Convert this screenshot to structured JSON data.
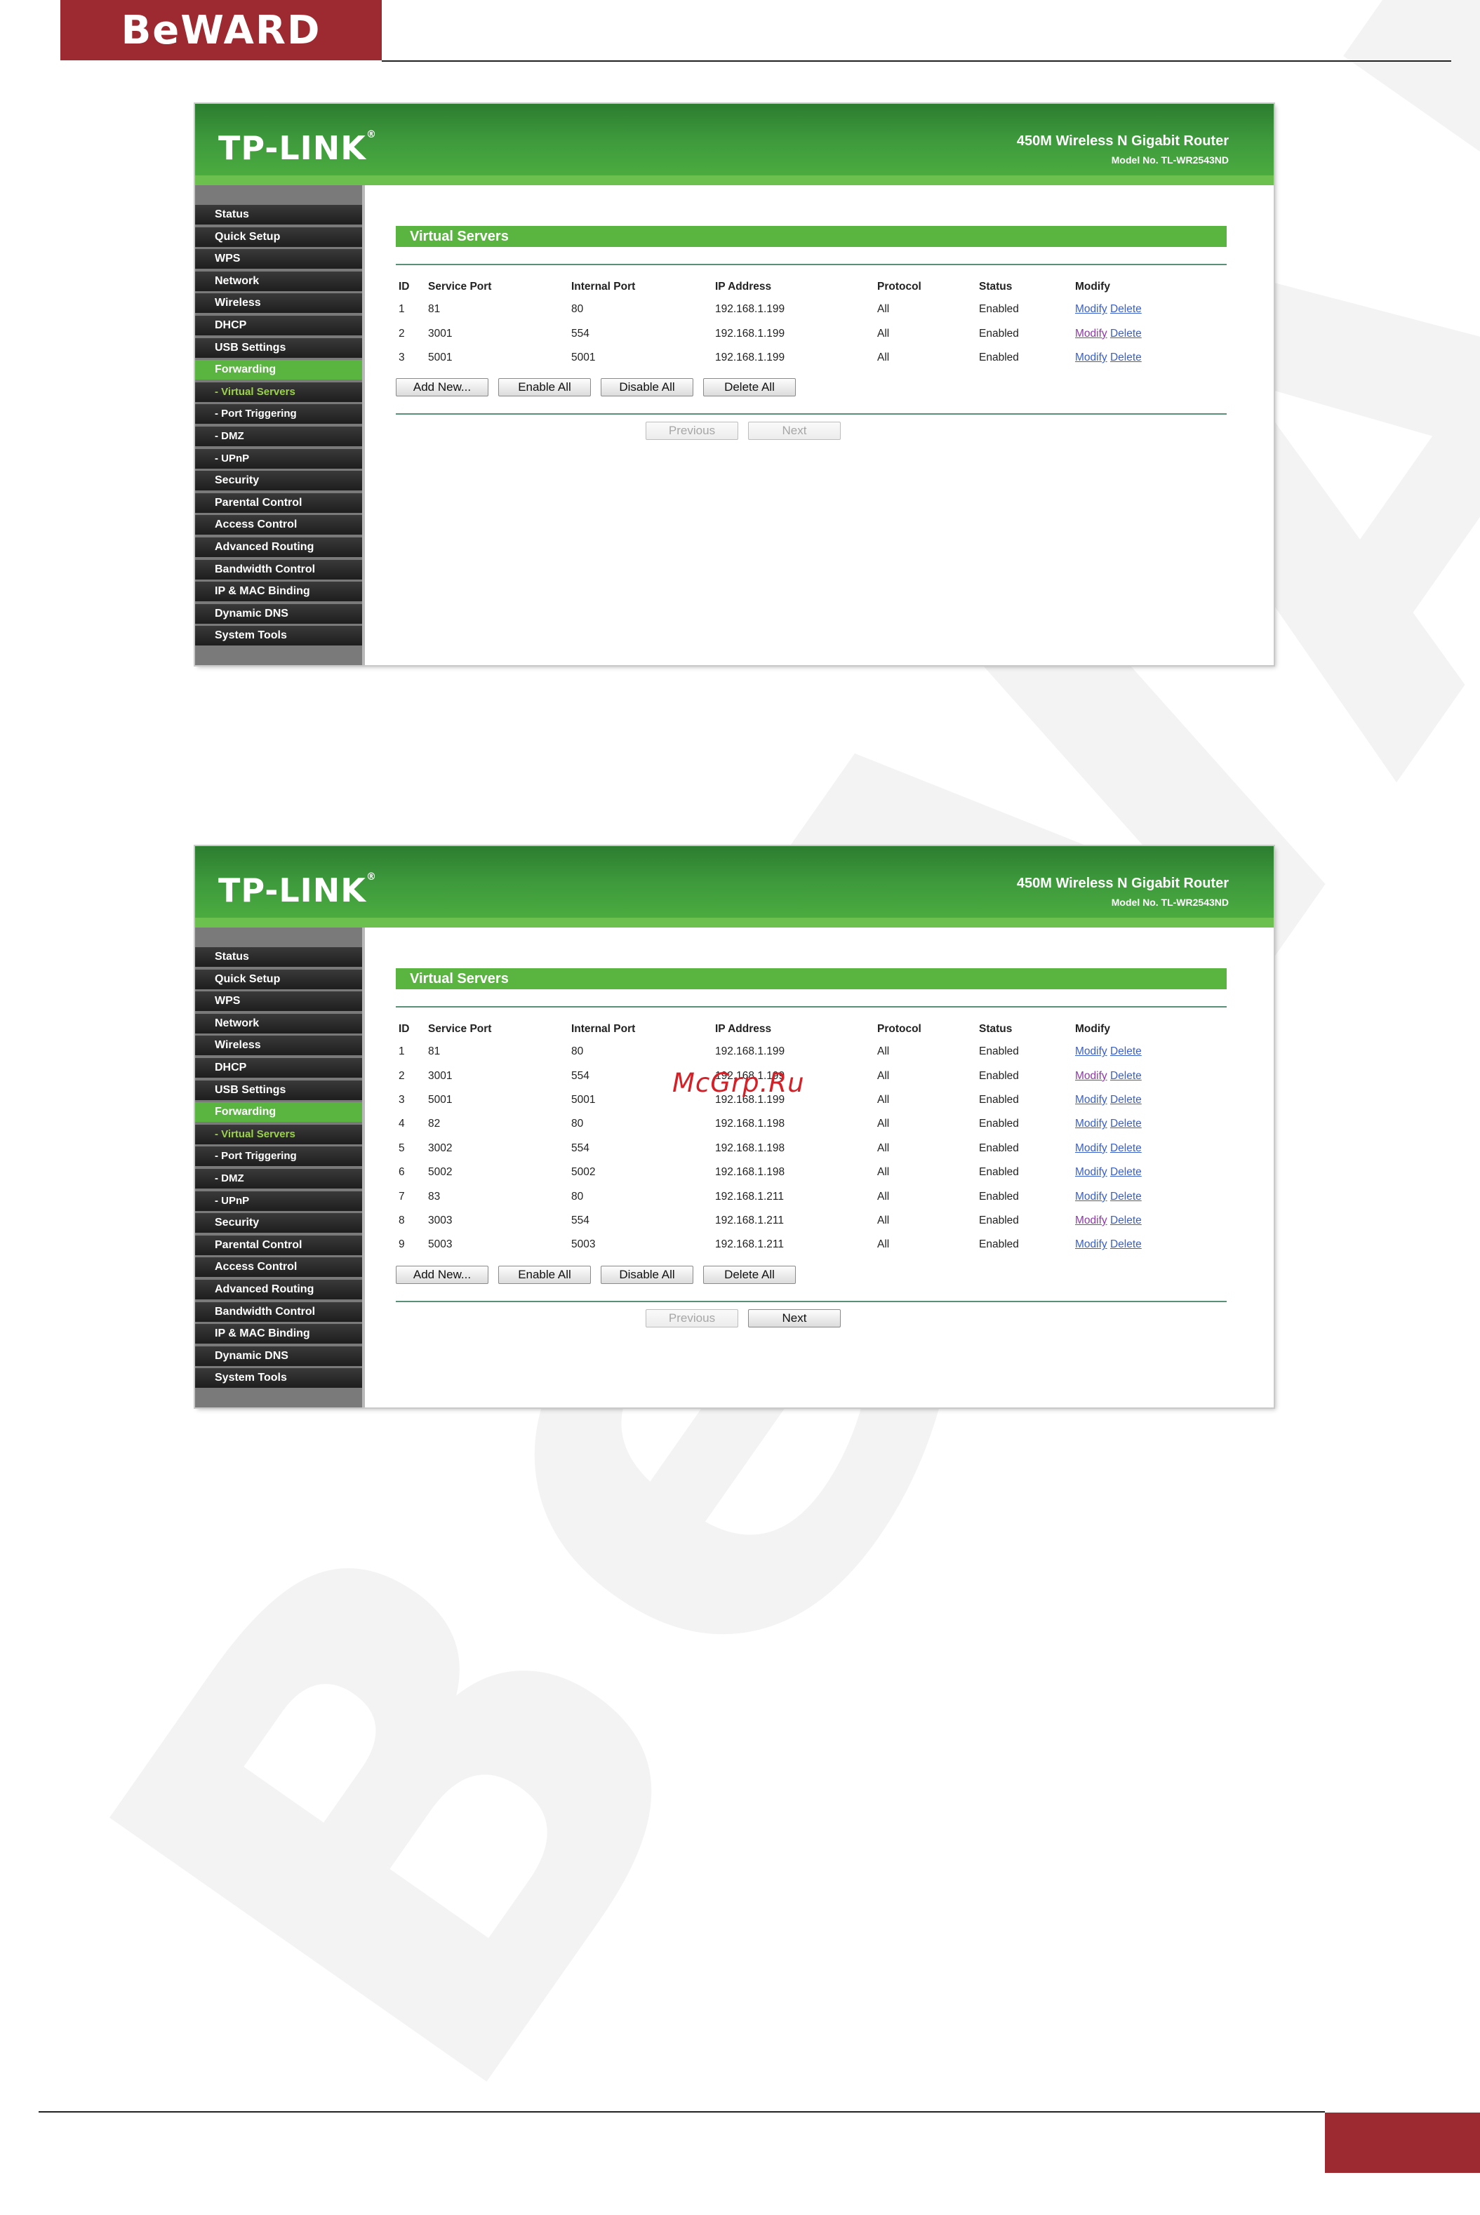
{
  "page": {
    "brand": "BeWARD",
    "watermark": "BeWARD",
    "site_watermark": "McGrp.Ru"
  },
  "router": {
    "logo": "TP-LINK",
    "logo_mark": "®",
    "name": "450M Wireless N Gigabit Router",
    "model": "Model No. TL-WR2543ND"
  },
  "menu": [
    {
      "label": "Status"
    },
    {
      "label": "Quick Setup"
    },
    {
      "label": "WPS"
    },
    {
      "label": "Network"
    },
    {
      "label": "Wireless"
    },
    {
      "label": "DHCP"
    },
    {
      "label": "USB Settings"
    },
    {
      "label": "Forwarding",
      "state": "active"
    },
    {
      "label": "- Virtual Servers",
      "state": "current"
    },
    {
      "label": "- Port Triggering"
    },
    {
      "label": "- DMZ"
    },
    {
      "label": "- UPnP"
    },
    {
      "label": "Security"
    },
    {
      "label": "Parental Control"
    },
    {
      "label": "Access Control"
    },
    {
      "label": "Advanced Routing"
    },
    {
      "label": "Bandwidth Control"
    },
    {
      "label": "IP & MAC Binding"
    },
    {
      "label": "Dynamic DNS"
    },
    {
      "label": "System Tools"
    }
  ],
  "section_title": "Virtual Servers",
  "columns": [
    "ID",
    "Service Port",
    "Internal Port",
    "IP Address",
    "Protocol",
    "Status",
    "Modify"
  ],
  "modify_label": "Modify",
  "delete_label": "Delete",
  "buttons": {
    "add_new": "Add New...",
    "enable_all": "Enable All",
    "disable_all": "Disable All",
    "delete_all": "Delete All",
    "previous": "Previous",
    "next": "Next"
  },
  "screens": [
    {
      "next_enabled": false,
      "rows": [
        {
          "id": "1",
          "service_port": "81",
          "internal_port": "80",
          "ip": "192.168.1.199",
          "protocol": "All",
          "status": "Enabled",
          "modify_visited": false
        },
        {
          "id": "2",
          "service_port": "3001",
          "internal_port": "554",
          "ip": "192.168.1.199",
          "protocol": "All",
          "status": "Enabled",
          "modify_visited": true
        },
        {
          "id": "3",
          "service_port": "5001",
          "internal_port": "5001",
          "ip": "192.168.1.199",
          "protocol": "All",
          "status": "Enabled",
          "modify_visited": false
        }
      ]
    },
    {
      "next_enabled": true,
      "rows": [
        {
          "id": "1",
          "service_port": "81",
          "internal_port": "80",
          "ip": "192.168.1.199",
          "protocol": "All",
          "status": "Enabled",
          "modify_visited": false
        },
        {
          "id": "2",
          "service_port": "3001",
          "internal_port": "554",
          "ip": "192.168.1.199",
          "protocol": "All",
          "status": "Enabled",
          "modify_visited": true
        },
        {
          "id": "3",
          "service_port": "5001",
          "internal_port": "5001",
          "ip": "192.168.1.199",
          "protocol": "All",
          "status": "Enabled",
          "modify_visited": false
        },
        {
          "id": "4",
          "service_port": "82",
          "internal_port": "80",
          "ip": "192.168.1.198",
          "protocol": "All",
          "status": "Enabled",
          "modify_visited": false
        },
        {
          "id": "5",
          "service_port": "3002",
          "internal_port": "554",
          "ip": "192.168.1.198",
          "protocol": "All",
          "status": "Enabled",
          "modify_visited": false
        },
        {
          "id": "6",
          "service_port": "5002",
          "internal_port": "5002",
          "ip": "192.168.1.198",
          "protocol": "All",
          "status": "Enabled",
          "modify_visited": false
        },
        {
          "id": "7",
          "service_port": "83",
          "internal_port": "80",
          "ip": "192.168.1.211",
          "protocol": "All",
          "status": "Enabled",
          "modify_visited": false
        },
        {
          "id": "8",
          "service_port": "3003",
          "internal_port": "554",
          "ip": "192.168.1.211",
          "protocol": "All",
          "status": "Enabled",
          "modify_visited": true
        },
        {
          "id": "9",
          "service_port": "5003",
          "internal_port": "5003",
          "ip": "192.168.1.211",
          "protocol": "All",
          "status": "Enabled",
          "modify_visited": false
        }
      ]
    }
  ]
}
